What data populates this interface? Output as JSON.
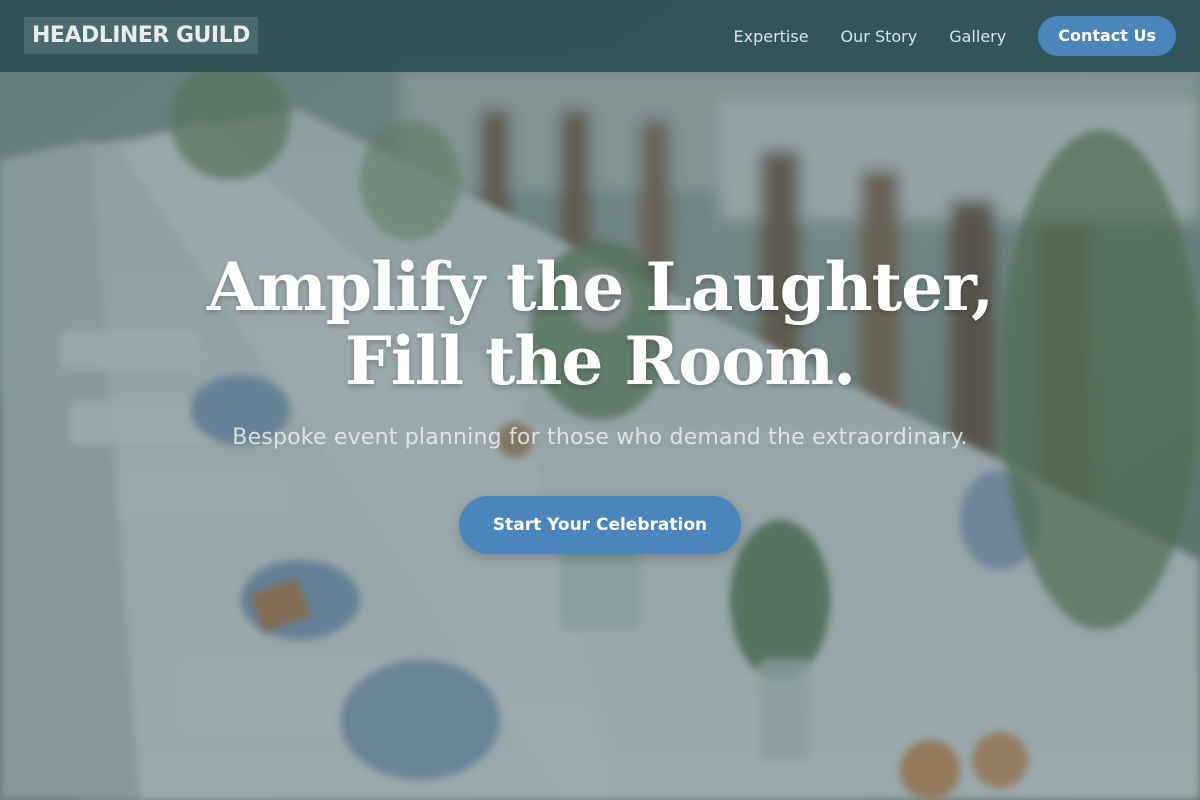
{
  "header": {
    "brand": "HEADLINER GUILD",
    "nav": [
      {
        "label": "Expertise"
      },
      {
        "label": "Our Story"
      },
      {
        "label": "Gallery"
      }
    ],
    "contact_label": "Contact Us"
  },
  "hero": {
    "title_line1": "Amplify the Laughter,",
    "title_line2": "Fill the Room.",
    "subtitle": "Bespoke event planning for those who demand the extraordinary.",
    "cta_label": "Start Your Celebration"
  },
  "colors": {
    "accent": "#4a86bb",
    "header_bg": "#2c5058",
    "overlay": "#264652"
  },
  "background": {
    "description_icon": "banquet-table-photo"
  }
}
